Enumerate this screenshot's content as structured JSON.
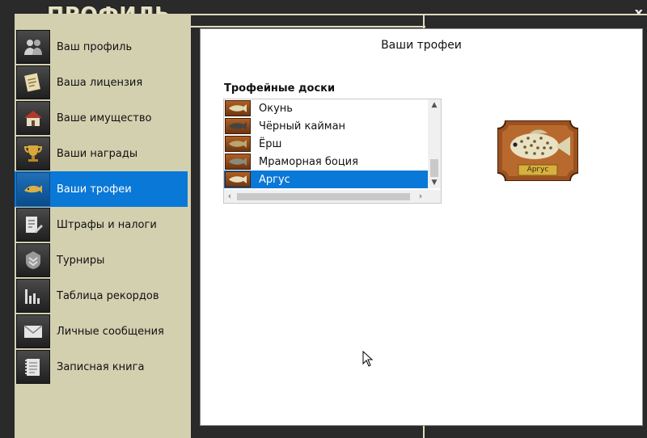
{
  "window": {
    "title": "ПРОФИЛЬ",
    "close_label": "x"
  },
  "sidebar": {
    "items": [
      {
        "label": "Ваш профиль",
        "icon": "users-icon",
        "active": false
      },
      {
        "label": "Ваша лицензия",
        "icon": "license-icon",
        "active": false
      },
      {
        "label": "Ваше имущество",
        "icon": "house-icon",
        "active": false
      },
      {
        "label": "Ваши награды",
        "icon": "trophy-cup-icon",
        "active": false
      },
      {
        "label": "Ваши трофеи",
        "icon": "trophy-fish-icon",
        "active": true
      },
      {
        "label": "Штрафы и налоги",
        "icon": "document-pen-icon",
        "active": false
      },
      {
        "label": "Турниры",
        "icon": "tournament-badge-icon",
        "active": false
      },
      {
        "label": "Таблица рекордов",
        "icon": "bar-chart-icon",
        "active": false
      },
      {
        "label": "Личные сообщения",
        "icon": "envelope-icon",
        "active": false
      },
      {
        "label": "Записная книга",
        "icon": "notebook-icon",
        "active": false
      }
    ]
  },
  "main": {
    "title": "Ваши трофеи",
    "boards_label": "Трофейные доски",
    "boards": [
      {
        "label": "Окунь",
        "selected": false
      },
      {
        "label": "Чёрный кайман",
        "selected": false
      },
      {
        "label": "Ёрш",
        "selected": false
      },
      {
        "label": "Мраморная боция",
        "selected": false
      },
      {
        "label": "Аргус",
        "selected": true
      }
    ],
    "preview": {
      "plaque_label": "Аргус",
      "icon": "fish-plaque-image"
    }
  },
  "colors": {
    "accent": "#0a78d7",
    "sidebar_bg": "#d3d0b0",
    "frame_bg": "#2a2a2a",
    "plaque_wood": "#9b5220"
  }
}
